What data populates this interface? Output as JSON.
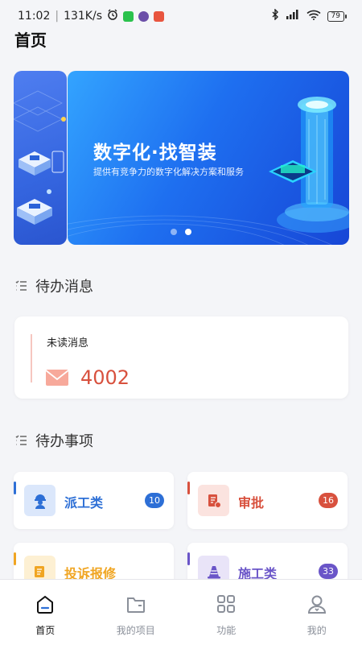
{
  "status_bar": {
    "time": "11:02",
    "speed": "131K/s",
    "battery": "79"
  },
  "page_title": "首页",
  "banner": {
    "title": "数字化·找智装",
    "subtitle": "提供有竞争力的数字化解决方案和服务",
    "slide_count": 2,
    "active_slide": 1
  },
  "todo_messages": {
    "heading": "待办消息",
    "unread_label": "未读消息",
    "unread_count": "4002"
  },
  "todo_items": {
    "heading": "待办事项",
    "items": [
      {
        "label": "派工类",
        "badge": "10",
        "color": "#2d6fd6",
        "accent": "#2d6fd6",
        "icon": "worker-icon",
        "bg": "#dbe7fb"
      },
      {
        "label": "审批",
        "badge": "16",
        "color": "#d8513e",
        "accent": "#d8513e",
        "icon": "approval-icon",
        "bg": "#fbe3df"
      },
      {
        "label": "投诉报修",
        "badge": "",
        "color": "#f0a522",
        "accent": "#f0a522",
        "icon": "complaint-icon",
        "bg": "#fdf0d3"
      },
      {
        "label": "施工类",
        "badge": "33",
        "color": "#6a55c8",
        "accent": "#6a55c8",
        "icon": "construction-cone-icon",
        "bg": "#e9e4f8"
      }
    ]
  },
  "tab_bar": {
    "tabs": [
      {
        "label": "首页",
        "icon": "home-icon",
        "active": true
      },
      {
        "label": "我的项目",
        "icon": "folder-icon",
        "active": false
      },
      {
        "label": "功能",
        "icon": "grid-icon",
        "active": false
      },
      {
        "label": "我的",
        "icon": "user-icon",
        "active": false
      }
    ]
  }
}
